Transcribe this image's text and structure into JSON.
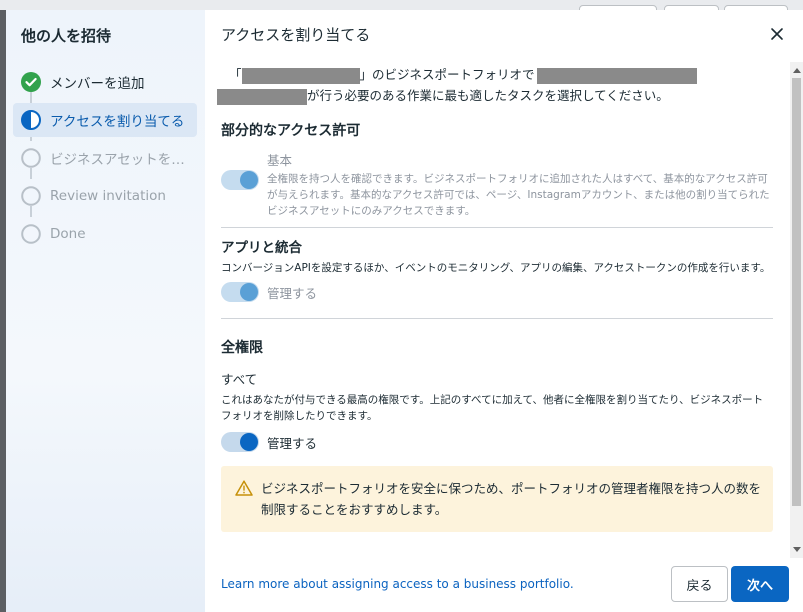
{
  "sidebar": {
    "title": "他の人を招待",
    "steps": [
      {
        "label": "メンバーを追加",
        "state": "done"
      },
      {
        "label": "アクセスを割り当てる",
        "state": "active"
      },
      {
        "label": "ビジネスアセットを割...",
        "state": "pending"
      },
      {
        "label": "Review invitation",
        "state": "pending"
      },
      {
        "label": "Done",
        "state": "pending"
      }
    ]
  },
  "header": {
    "title": "アクセスを割り当てる"
  },
  "intro": {
    "part1": "「",
    "part2": "」のビジネスポートフォリオで",
    "part3": "が行う必要のある作業に最も適したタスクを選択してください。"
  },
  "partial": {
    "title": "部分的なアクセス許可",
    "basic_name": "基本",
    "basic_desc": "全権限を持つ人を確認できます。ビジネスポートフォリオに追加された人はすべて、基本的なアクセス許可が与えられます。基本的なアクセス許可では、ページ、Instagramアカウント、または他の割り当てられたビジネスアセットにのみアクセスできます。",
    "apps_title": "アプリと統合",
    "apps_desc": "コンバージョンAPIを設定するほか、イベントのモニタリング、アプリの編集、アクセストークンの作成を行います。",
    "apps_toggle_label": "管理する"
  },
  "full": {
    "title": "全権限",
    "all_title": "すべて",
    "all_desc": "これはあなたが付与できる最高の権限です。上記のすべてに加えて、他者に全権限を割り当てたり、ビジネスポートフォリオを削除したりできます。",
    "all_toggle_label": "管理する"
  },
  "warning": {
    "text": "ビジネスポートフォリオを安全に保つため、ポートフォリオの管理者権限を持つ人の数を制限することをおすすめします。"
  },
  "footer": {
    "learn_link": "Learn more about assigning access to a business portfolio.",
    "back_label": "戻る",
    "next_label": "次へ"
  },
  "colors": {
    "accent": "#0a66c2",
    "done_green": "#31a24c",
    "warning_bg": "#fdf3dc",
    "warning_icon": "#c69009"
  },
  "icons": [
    "check-circle-icon",
    "half-circle-icon",
    "empty-circle-icon",
    "close-icon",
    "warning-triangle-icon"
  ]
}
